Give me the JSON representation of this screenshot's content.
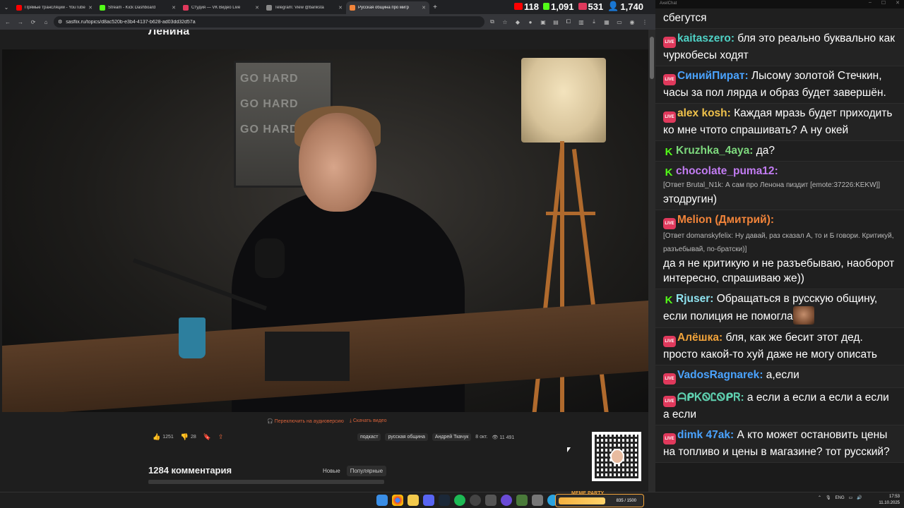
{
  "browser": {
    "tabs": [
      {
        "label": "Прямые трансляции - YouTube",
        "favicon_color": "#ff0000"
      },
      {
        "label": "Stream - Kick Dashboard",
        "favicon_color": "#53fc18"
      },
      {
        "label": "Студия — VK Видео Live",
        "favicon_color": "#e0395c"
      },
      {
        "label": "Telegram: View @banksta",
        "favicon_color": "#888888"
      },
      {
        "label": "Русская община про мигр",
        "favicon_color": "#f2843a"
      }
    ],
    "url": "sasflix.ru/topics/d8ac520b-e3b4-4137-b628-ad03dd32d57a"
  },
  "live_stats": {
    "youtube": "118",
    "kick": "1,091",
    "vk": "531",
    "total": "1,740"
  },
  "page": {
    "title": "Ленина",
    "switch_audio": "Переключить на аудиоверсию",
    "download_video": "Скачать видео",
    "likes": "1251",
    "dislikes": "28",
    "tags": [
      "подкаст",
      "русская община",
      "Андрей Ткачук"
    ],
    "date": "8 окт.",
    "views": "11 491",
    "comments_title": "1284 комментария",
    "sort_new": "Новые",
    "sort_popular": "Популярные"
  },
  "chat": {
    "window_title": "AxelChat",
    "messages": [
      {
        "platform": "",
        "user": "",
        "color": "#ffffff",
        "reply": "",
        "text": "сбегутся"
      },
      {
        "platform": "vk",
        "user": "kaitaszero",
        "color": "#4fd1c5",
        "reply": "",
        "text": "бля это реально буквально как чуркобесы ходят"
      },
      {
        "platform": "vk",
        "user": "СинийПират",
        "color": "#4aa3ff",
        "reply": "",
        "text": "Лысому золотой Стечкин, часы за пол лярда и образ будет завершён."
      },
      {
        "platform": "vk",
        "user": "alex kosh",
        "color": "#f0c24b",
        "reply": "",
        "text": "Каждая мразь будет приходить ко мне чтото спрашивать? А ну окей"
      },
      {
        "platform": "kick",
        "user": "Kruzhka_4aya",
        "color": "#7dd87d",
        "reply": "",
        "text": "да?"
      },
      {
        "platform": "kick",
        "user": "chocolate_puma12",
        "color": "#c27cf2",
        "reply": "[Ответ Brutal_N1k: А сам про Ленона пиздит [emote:37226:KEKW]]",
        "text": "этодругин)"
      },
      {
        "platform": "vk",
        "user": "Melion (Дмитрий)",
        "color": "#f2843a",
        "reply": "[Ответ domanskyfelix: Ну давай, раз сказал А, то и Б говори. Критикуй, разъебывай, по-братски)]",
        "text": "да я не критикую и не разъебываю, наоборот интересно, спрашиваю же))"
      },
      {
        "platform": "kick",
        "user": "Rjuser",
        "color": "#8fe3f0",
        "reply": "",
        "text": "Обращаться в русскую общину, если полиция не помогла",
        "emote": true
      },
      {
        "platform": "vk",
        "user": "Алёшка",
        "color": "#f2a33a",
        "reply": "",
        "text": "бля, как же бесит этот дед. просто какой-то хуй даже не могу описать"
      },
      {
        "platform": "vk",
        "user": "VadosRagnarek",
        "color": "#4aa3ff",
        "reply": "",
        "text": "а,если"
      },
      {
        "platform": "vk",
        "user": "ᗩᑭᏦᏫᏝᏫᑭᏒ",
        "color": "#5fd1b0",
        "reply": "",
        "text": "а если а если а если а если а если"
      },
      {
        "platform": "vk",
        "user": "dimk 47ak",
        "color": "#4aa3ff",
        "reply": "",
        "text": "А кто может остановить цены на топливо и цены в магазине? тот русский?"
      }
    ]
  },
  "taskbar": {
    "meme_party_label": "MEME PARTY",
    "meme_party_progress": "835 / 1500",
    "lang": "ENG",
    "time": "17:53",
    "date": "11.10.2025"
  }
}
